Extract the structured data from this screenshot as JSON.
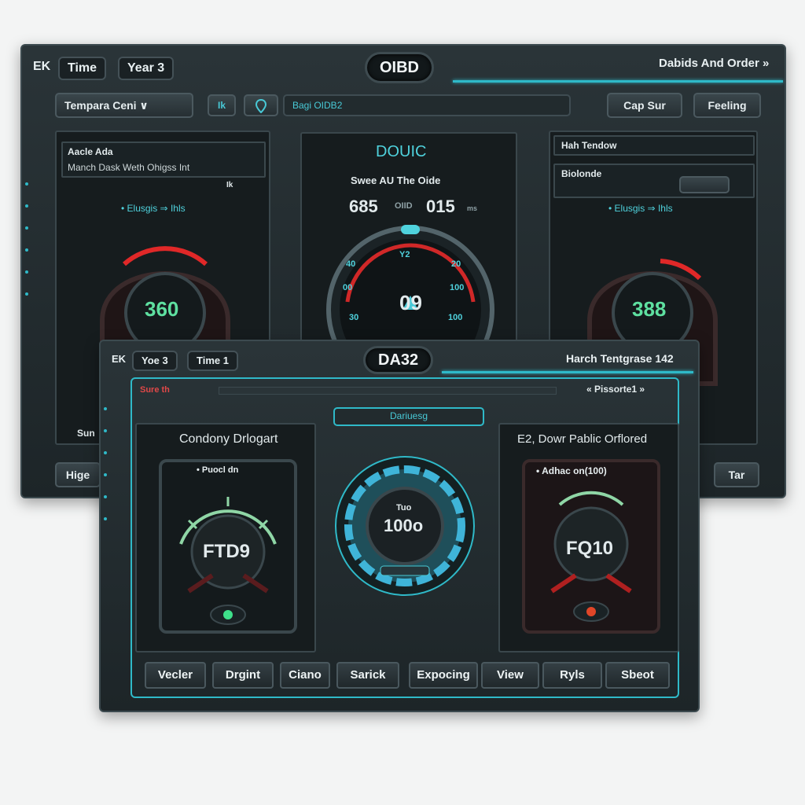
{
  "back_window": {
    "chips": [
      "EK",
      "Time",
      "Year 3"
    ],
    "title": "OIBD",
    "title_right": "Dabids And Order »",
    "toolbar": {
      "temp_select": "Tempara Ceni ∨",
      "small_btn": "Ik",
      "search_placeholder": "Bagi OIDB2",
      "btn_right_1": "Cap Sur",
      "btn_right_2": "Feeling"
    },
    "left_panel": {
      "header": "Aacle Ada",
      "sub_header": "Manch Dask Weth Ohigss Int",
      "sub_extra": "Ik",
      "status": "• Elusgis ⇒ Ihls",
      "readout": "360"
    },
    "center_panel": {
      "title": "DOUIC",
      "subtitle": "Swee AU The Oide",
      "stat_left": "685",
      "stat_mid": "OIID",
      "stat_right": "015",
      "stat_unit": "ms",
      "gauge_ticks": [
        "40",
        "Y2",
        "20",
        "00",
        "100",
        "30",
        "100"
      ],
      "gauge_center": "09"
    },
    "right_panel": {
      "header": "Hah Tendow",
      "sub_header": "Biolonde",
      "status": "• Elusgis ⇒ Ihls",
      "readout": "388"
    },
    "bottom_left_btn": "Hige",
    "bottom_right_btn": "Tar",
    "bottom_left_label": "Sun"
  },
  "front_window": {
    "chips": [
      "EK",
      "Yoe 3",
      "Time 1"
    ],
    "title": "DA32",
    "title_right": "Harch Tentgrase 142",
    "status_left": "Sure th",
    "nav_right": "« Pissorte1 »",
    "tab_label": "Dariuesg",
    "left_panel": {
      "title": "Condony Drlogart",
      "sub": "• Puocl dn",
      "readout": "FTD9"
    },
    "center_dial": {
      "label": "Tuo",
      "value": "100o"
    },
    "right_panel": {
      "title": "E2, Dowr Pablic Orflored",
      "sub": "• Adhac on(100)",
      "readout": "FQ10"
    },
    "buttons": [
      "Vecler",
      "Drgint",
      "Ciano",
      "Sarick",
      "Expocing",
      "View",
      "Ryls",
      "Sbeot"
    ]
  },
  "colors": {
    "accent": "#2fb9c8",
    "window_bg": "#222b2e",
    "danger": "#d6262a",
    "readout_green": "#5ee0a0"
  }
}
